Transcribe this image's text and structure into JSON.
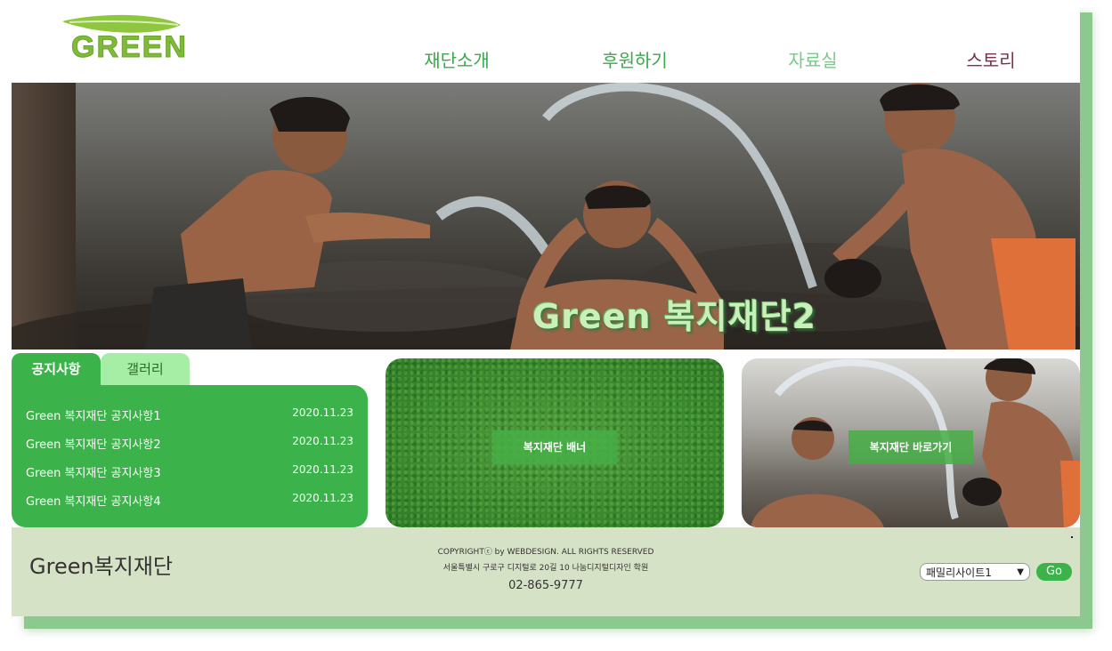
{
  "header": {
    "logo_text": "GREEN",
    "nav": [
      "재단소개",
      "후원하기",
      "자료실",
      "스토리"
    ]
  },
  "hero": {
    "caption": "Green 복지재단2"
  },
  "notice": {
    "tabs": [
      "공지사항",
      "갤러리"
    ],
    "items": [
      {
        "title": "Green 복지재단 공지사항1",
        "date": "2020.11.23"
      },
      {
        "title": "Green 복지재단 공지사항2",
        "date": "2020.11.23"
      },
      {
        "title": "Green 복지재단 공지사항3",
        "date": "2020.11.23"
      },
      {
        "title": "Green 복지재단 공지사항4",
        "date": "2020.11.23"
      }
    ]
  },
  "banners": {
    "left_label": "복지재단 배너",
    "right_label": "복지재단 바로가기"
  },
  "footer": {
    "brand": "Green복지재단",
    "copyright": "COPYRIGHTⓒ by WEBDESIGN. ALL RIGHTS RESERVED",
    "address": "서울특별시 구로구 디지털로 20길 10 나눔디지털디자인 학원",
    "phone": "02-865-9777",
    "family_site": "패밀리사이트1",
    "go": "Go"
  },
  "colors": {
    "brand_green": "#3bb24a",
    "light_green": "#a6eea6",
    "footer_bg": "#d6e2c6",
    "nav_story": "#7a3148"
  }
}
